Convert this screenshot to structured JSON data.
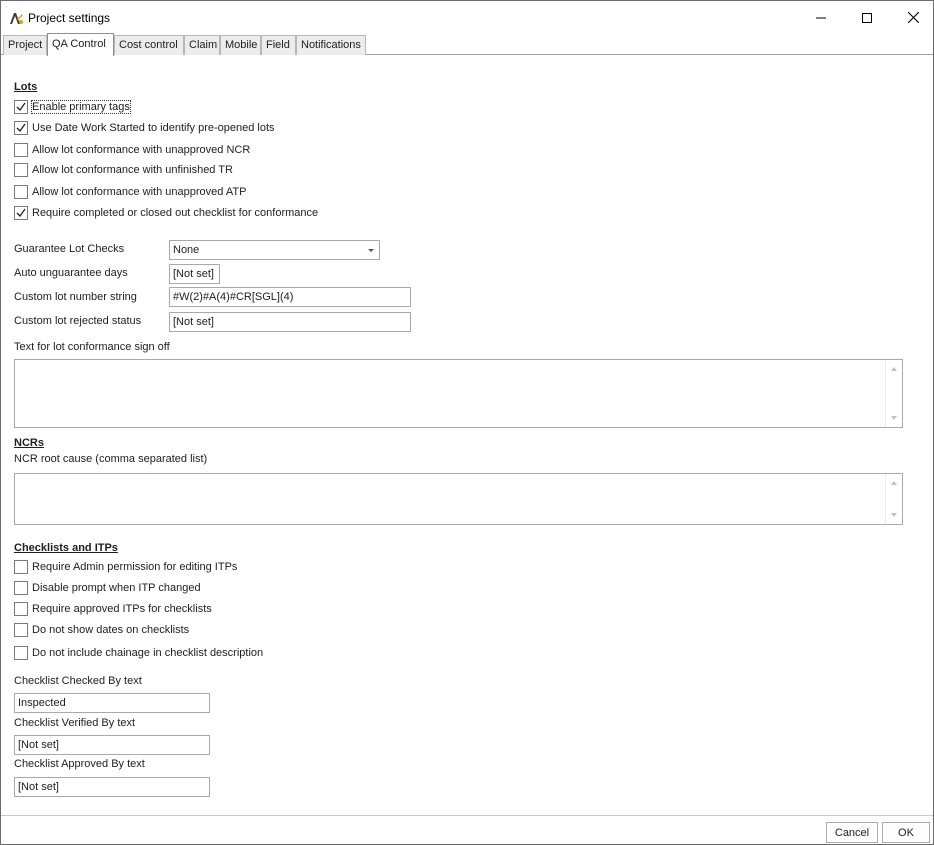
{
  "window": {
    "title": "Project settings"
  },
  "tabs": [
    {
      "label": "Project"
    },
    {
      "label": "QA Control"
    },
    {
      "label": "Cost control"
    },
    {
      "label": "Claim"
    },
    {
      "label": "Mobile"
    },
    {
      "label": "Field"
    },
    {
      "label": "Notifications"
    }
  ],
  "active_tab": "QA Control",
  "lots": {
    "title": "Lots",
    "checkboxes": [
      {
        "label": "Enable primary tags",
        "checked": true
      },
      {
        "label": "Use Date Work Started to identify pre-opened lots",
        "checked": true
      },
      {
        "label": "Allow lot conformance with unapproved NCR",
        "checked": false
      },
      {
        "label": "Allow lot conformance with unfinished TR",
        "checked": false
      },
      {
        "label": "Allow lot conformance with unapproved ATP",
        "checked": false
      },
      {
        "label": "Require completed or closed out checklist for conformance",
        "checked": true
      }
    ],
    "guarantee_label": "Guarantee Lot Checks",
    "guarantee_value": "None",
    "auto_unguarantee_label": "Auto unguarantee days",
    "auto_unguarantee_value": "[Not set]",
    "custom_lot_number_label": "Custom lot number string",
    "custom_lot_number_value": "#W(2)#A(4)#CR[SGL](4)",
    "custom_rejected_label": "Custom lot rejected status",
    "custom_rejected_value": "[Not set]",
    "signoff_label": "Text for lot conformance sign off",
    "signoff_value": ""
  },
  "ncrs": {
    "title": "NCRs",
    "root_cause_label": "NCR root cause (comma separated list)",
    "root_cause_value": ""
  },
  "checklists": {
    "title": "Checklists and ITPs",
    "checkboxes": [
      {
        "label": "Require Admin permission for editing ITPs",
        "checked": false
      },
      {
        "label": "Disable prompt when ITP changed",
        "checked": false
      },
      {
        "label": "Require approved ITPs for checklists",
        "checked": false
      },
      {
        "label": "Do not show dates on checklists",
        "checked": false
      },
      {
        "label": "Do not include chainage in checklist description",
        "checked": false
      }
    ],
    "checked_by_label": "Checklist Checked By text",
    "checked_by_value": "Inspected",
    "verified_by_label": "Checklist Verified By text",
    "verified_by_value": "[Not set]",
    "approved_by_label": "Checklist Approved By text",
    "approved_by_value": "[Not set]"
  },
  "buttons": {
    "cancel": "Cancel",
    "ok": "OK"
  },
  "icons": {
    "app": "app-logo-icon",
    "minimize": "minimize-icon",
    "maximize": "maximize-icon",
    "close": "close-icon"
  }
}
